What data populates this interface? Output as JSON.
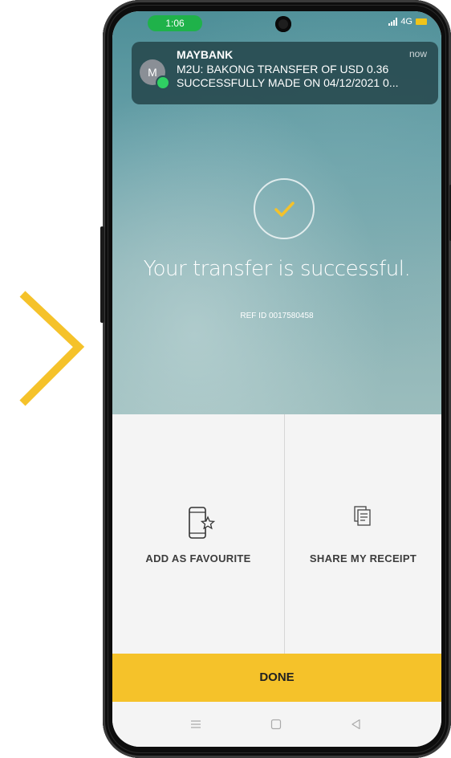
{
  "status_bar": {
    "time": "1:06",
    "network": "4G"
  },
  "notification": {
    "avatar_letter": "M",
    "app_name": "MAYBANK",
    "time": "now",
    "line1": "M2U: BAKONG TRANSFER OF USD 0.36",
    "line2": "SUCCESSFULLY MADE ON 04/12/2021 0..."
  },
  "result": {
    "message": "Your transfer is successful.",
    "ref_id": "REF ID 0017580458"
  },
  "actions": {
    "favourite_label": "ADD AS FAVOURITE",
    "share_label": "SHARE MY RECEIPT"
  },
  "done_label": "DONE",
  "colors": {
    "accent": "#f5c22a",
    "hero_top": "#4e8f98",
    "check": "#f5c22a",
    "notif_badge": "#2fd063",
    "time_pill": "#1fb24a"
  },
  "icons": [
    "chevron-right-icon",
    "check-icon",
    "phone-star-icon",
    "receipt-icon",
    "menu-icon",
    "square-icon",
    "back-triangle-icon"
  ]
}
